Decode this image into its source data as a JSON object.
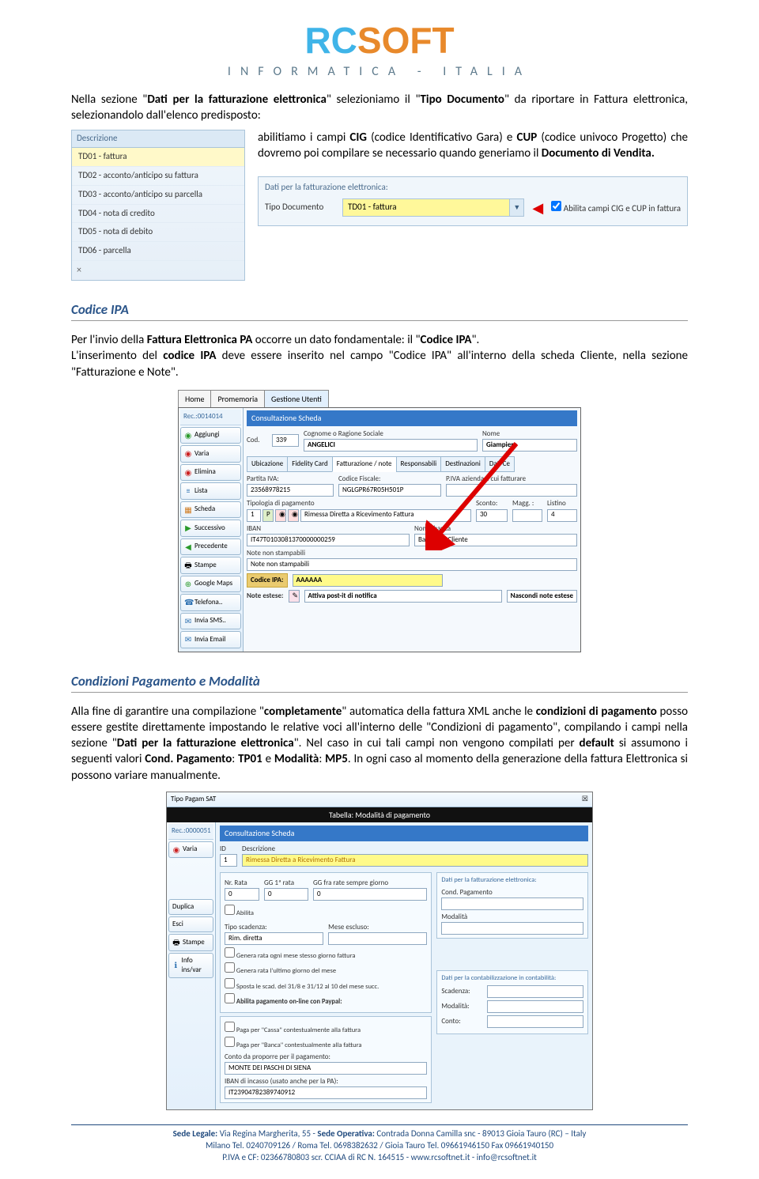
{
  "logo": {
    "t1": "RC",
    "t2": "SOFT",
    "sub": "INFORMATICA   -   ITALIA"
  },
  "para1": {
    "a": "Nella sezione \"",
    "b": "Dati per la fatturazione elettronica",
    "c": "\" selezioniamo il \"",
    "d": "Tipo Documento",
    "e": "\" da riportare in Fattura elettronica, selezionandolo dall'elenco predisposto: ",
    "e1": "abilitiamo i campi ",
    "f": "CIG",
    "g": " (codice Identificativo Gara) e ",
    "h": "CUP",
    "i": " (codice univoco Progetto) che dovremo poi compilare se  necessario quando generiamo il ",
    "j": "Documento di Vendita.",
    "dropdown_header": "Descrizione",
    "dropdown_items": [
      "TD01 - fattura",
      "TD02 - acconto/anticipo su fattura",
      "TD03 - acconto/anticipo su parcella",
      "TD04 - nota di credito",
      "TD05 - nota di debito",
      "TD06 - parcella"
    ],
    "close_icon": "×",
    "panel_title": "Dati per la fatturazione elettronica:",
    "panel_label": "Tipo Documento",
    "panel_value": "TD01 - fattura",
    "panel_check": "Abilita campi CIG e CUP in fattura"
  },
  "s2": {
    "title": "Codice IPA",
    "p1a": "Per l'invio della ",
    "p1b": "Fattura Elettronica PA",
    "p1c": " occorre un dato fondamentale: il \"",
    "p1d": "Codice IPA",
    "p1e": "\".",
    "p2a": "L'inserimento del ",
    "p2b": "codice IPA",
    "p2c": " deve essere inserito nel campo \"Codice IPA\" all'interno della scheda Cliente, nella sezione \"Fatturazione e Note\".",
    "tabs": [
      "Home",
      "Promemoria",
      "Gestione Utenti"
    ],
    "rec": "Rec.:0014014",
    "sidebar": [
      "Aggiungi",
      "Varia",
      "Elimina",
      "Lista",
      "Scheda",
      "Successivo",
      "Precedente",
      "Stampe",
      "Google Maps",
      "Telefona..",
      "Invia SMS..",
      "Invia Email"
    ],
    "bluebar": "Consultazione Scheda",
    "cod_lbl": "Cod.",
    "cod_val": "339",
    "rag_lbl": "Cognome o Ragione Sociale",
    "rag_val": "ANGELICI",
    "nome_lbl": "Nome",
    "nome_val": "Giampiero",
    "subtabs": [
      "Ubicazione",
      "Fidelity Card",
      "Fatturazione / note",
      "Responsabili",
      "Destinazioni",
      "Dati Ce"
    ],
    "piva_lbl": "Partita IVA:",
    "piva_val": "23568978215",
    "cf_lbl": "Codice Fiscale:",
    "cf_val": "NGLGPR67R05H501P",
    "pivaaz_lbl": "P.IVA azienda a cui fatturare",
    "tip_lbl": "Tipologia di pagamento",
    "tip_val": "Rimessa Diretta a Ricevimento Fattura",
    "tip_n": "1",
    "sc_lbl": "Sconto:",
    "sc_val": "30",
    "magg_lbl": "Magg. :",
    "list_lbl": "Listino",
    "list_val": "4",
    "iban_lbl": "IBAN",
    "iban_val": "IT47T0103081370000000259",
    "nbanca_lbl": "Nome banca",
    "nbanca_val": "Banca del Cliente",
    "nns_lbl": "Note non stampabili",
    "nns_val": "Note non stampabili",
    "ipa_lbl": "Codice IPA:",
    "ipa_val": "AAAAAA",
    "ne_lbl": "Note estese:",
    "postit": "Attiva post-it di notifica",
    "nasc": "Nascondi note estese"
  },
  "s3": {
    "title": "Condizioni Pagamento  e Modalità",
    "p_a": "Alla fine di garantire una compilazione \"",
    "p_b": "completamente",
    "p_c": "\" automatica della fattura XML anche le ",
    "p_d": "condizioni di pagamento",
    "p_e": " posso essere gestite direttamente impostando le relative voci all'interno delle \"Condizioni di pagamento\", compilando i campi nella sezione \"",
    "p_f": "Dati per la fatturazione elettronica",
    "p_g": "\". Nel caso in cui tali campi non vengono compilati per ",
    "p_h": "default",
    "p_i": " si assumono i seguenti valori ",
    "p_j": "Cond. Pagamento",
    "p_k": ":",
    "p_l": " TP01",
    "p_m": " e ",
    "p_n": "Modalità",
    "p_o": ":",
    "p_p": " MP5",
    "p_q": ". In ogni caso al momento della generazione della fattura Elettronica si possono variare manualmente.",
    "top_left": "Tipo Pagam SAT",
    "titlebar": "Tabella: Modalità di pagamento",
    "rec": "Rec.:0000051",
    "sidebar": [
      "Varia",
      "Duplica",
      "Esci",
      "Stampe",
      "Info ins/var"
    ],
    "bluebar": "Consultazione Scheda",
    "id_lbl": "ID",
    "id_val": "1",
    "desc_lbl": "Descrizione",
    "desc_val": "Rimessa Diretta a Ricevimento Fattura",
    "nr_lbl": "Nr. Rata",
    "nr_val": "0",
    "gg1_lbl": "GG 1ª rata",
    "gg1_val": "0",
    "ggfra_lbl": "GG fra rate sempre giorno",
    "ggfra_val": "0",
    "ab_lbl": "Abilita",
    "tipo_lbl": "Tipo scadenza:",
    "tipo_val": "Rim. diretta",
    "mese_lbl": "Mese escluso:",
    "chk1": "Genera rata ogni mese stesso giorno fattura",
    "chk2": "Genera rata l'ultimo giorno del mese",
    "chk3": "Sposta le scad. del 31/8 e 31/12 al 10 del mese succ.",
    "chk_paypal": "Abilita pagamento on-line con Paypal:",
    "grp_fe": "Dati per la fatturazione elettronica:",
    "fe1": "Cond. Pagamento",
    "fe2": "Modalità",
    "chk_cassa": "Paga per \"Cassa\" contestualmente alla fattura",
    "chk_banca": "Paga per \"Banca\" contestualmente alla fattura",
    "conto_lbl": "Conto da proporre per il pagamento:",
    "conto_val": "MONTE DEI PASCHI DI SIENA",
    "ibanpa_lbl": "IBAN di incasso (usato anche per la PA):",
    "ibanpa_val": "IT23904782389740912",
    "grp_cont": "Dati per la contabilizzazione in contabilità:",
    "scad": "Scadenza:",
    "modal": "Modalità:",
    "conto": "Conto:"
  },
  "footer": {
    "l1a": "Sede Legale: ",
    "l1b": "Via Regina Margherita, 55  - ",
    "l1c": "Sede Operativa: ",
    "l1d": "Contrada Donna Camilla snc - 89013 Gioia Tauro (RC) – Italy",
    "l2": "Milano Tel. 0240709126  /  Roma Tel. 0698382632  /  Gioia Tauro Tel. 09661946150  Fax 09661940150",
    "l3a": "P.IVA e CF: 02366780803  scr. CCIAA di RC N. 164515 - ",
    "l3b": "www.rcsoftnet.it",
    "l3c": "   -   ",
    "l3d": "info@rcsoftnet.it"
  }
}
